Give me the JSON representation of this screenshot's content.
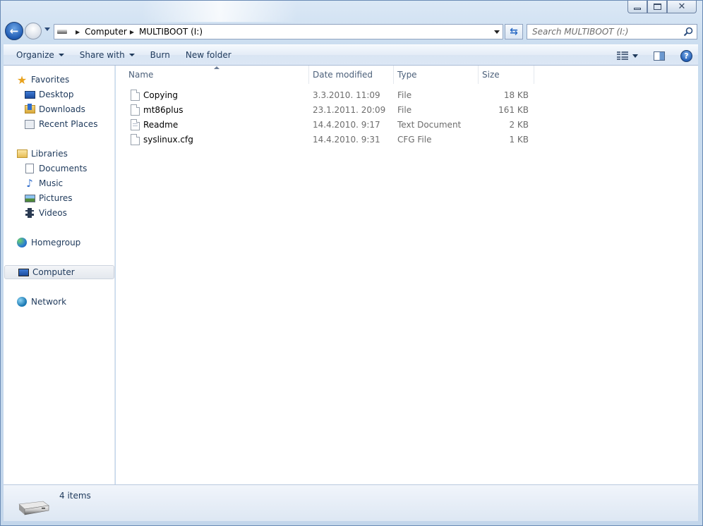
{
  "window": {
    "caption_buttons": {
      "minimize": "minimize-icon",
      "maximize": "maximize-icon",
      "close": "close-icon"
    }
  },
  "nav": {
    "breadcrumbs": [
      "Computer",
      "MULTIBOOT (I:)"
    ],
    "search_placeholder": "Search MULTIBOOT (I:)"
  },
  "toolbar": {
    "organize": "Organize",
    "share_with": "Share with",
    "burn": "Burn",
    "new_folder": "New folder"
  },
  "navpane": {
    "favorites": "Favorites",
    "desktop": "Desktop",
    "downloads": "Downloads",
    "recent_places": "Recent Places",
    "libraries": "Libraries",
    "documents": "Documents",
    "music": "Music",
    "pictures": "Pictures",
    "videos": "Videos",
    "homegroup": "Homegroup",
    "computer": "Computer",
    "network": "Network"
  },
  "columns": {
    "name": "Name",
    "date_modified": "Date modified",
    "type": "Type",
    "size": "Size"
  },
  "files": [
    {
      "name": "Copying",
      "date": "3.3.2010. 11:09",
      "type": "File",
      "size": "18 KB"
    },
    {
      "name": "mt86plus",
      "date": "23.1.2011. 20:09",
      "type": "File",
      "size": "161 KB"
    },
    {
      "name": "Readme",
      "date": "14.4.2010. 9:17",
      "type": "Text Document",
      "size": "2 KB"
    },
    {
      "name": "syslinux.cfg",
      "date": "14.4.2010. 9:31",
      "type": "CFG File",
      "size": "1 KB"
    }
  ],
  "details": {
    "item_count": "4 items"
  }
}
